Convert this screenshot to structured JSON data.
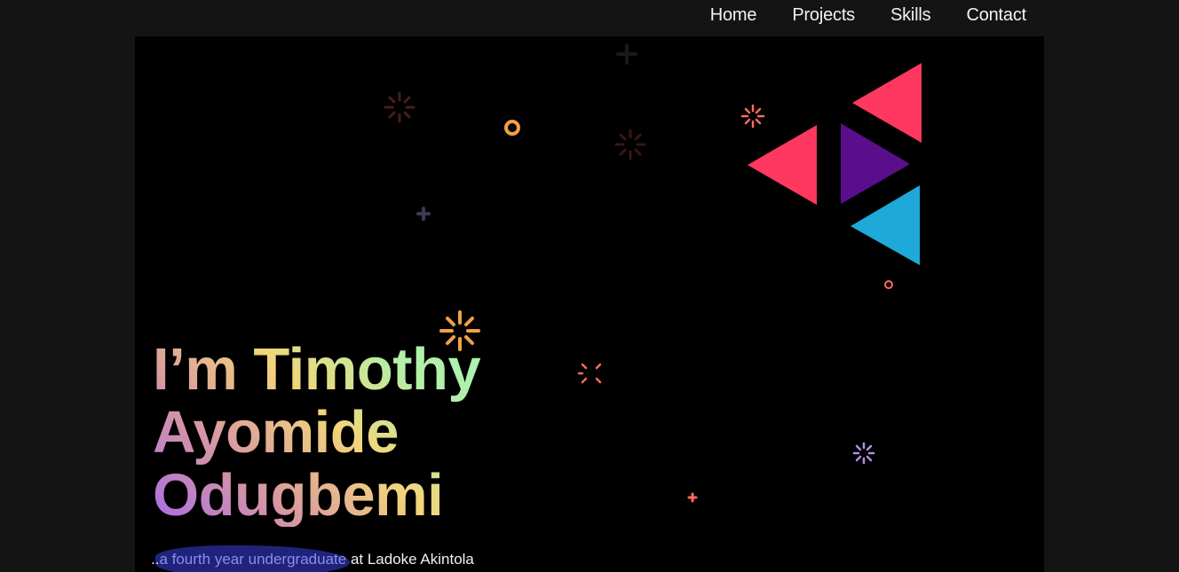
{
  "nav": {
    "items": [
      {
        "label": "Home"
      },
      {
        "label": "Projects"
      },
      {
        "label": "Skills"
      },
      {
        "label": "Contact"
      }
    ]
  },
  "hero": {
    "title_lines": [
      "I’m Timothy",
      "Ayomide",
      "Odugbemi"
    ],
    "subtitle_prefix": "..",
    "subtitle_highlight": "a fourth year undergraduate",
    "subtitle_rest": " at Ladoke Akintola"
  },
  "colors": {
    "page_bg": "#141414",
    "hero_bg": "#000000",
    "triangle_red": "#ff3860",
    "triangle_purple": "#5a0e8c",
    "triangle_blue": "#1fa9d8",
    "highlight_bg": "#1f237a",
    "highlight_text": "#8a8cf0"
  }
}
